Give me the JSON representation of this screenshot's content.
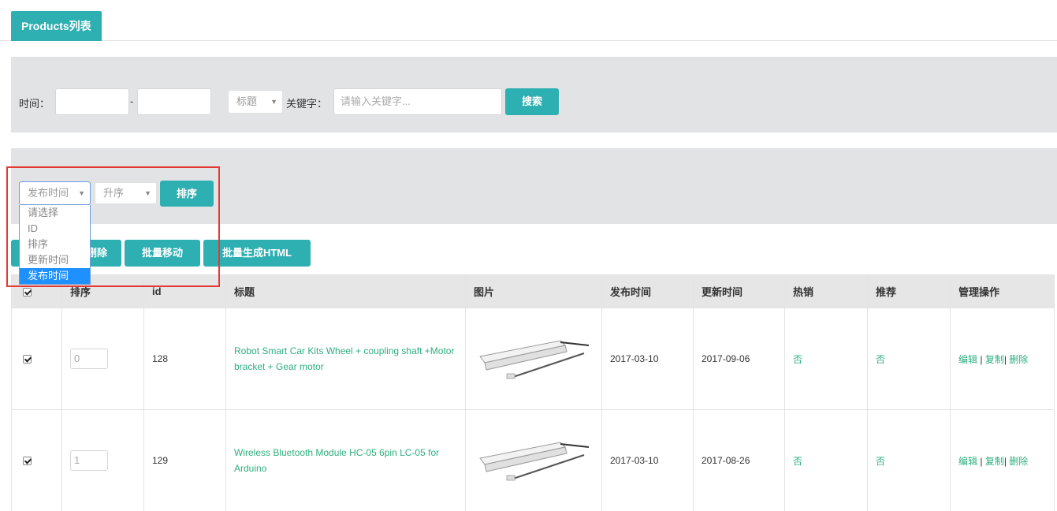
{
  "tab": {
    "label": "Products列表"
  },
  "search": {
    "time_label": "时间：",
    "dash": "-",
    "field_select": "标题",
    "keyword_label": "关键字：",
    "keyword_placeholder": "请输入关键字...",
    "search_button": "搜索"
  },
  "sort": {
    "field_select": "发布时间",
    "order_select": "升序",
    "sort_button": "排序",
    "options": [
      "请选择",
      "ID",
      "排序",
      "更新时间",
      "发布时间"
    ],
    "selected_option": "发布时间"
  },
  "toolbar": {
    "delete_button": "删除",
    "move_button": "批量移动",
    "html_button": "批量生成HTML"
  },
  "table": {
    "headers": [
      "排序",
      "id",
      "标题",
      "图片",
      "发布时间",
      "更新时间",
      "热销",
      "推荐",
      "管理操作"
    ],
    "rows": [
      {
        "sort": "0",
        "id": "128",
        "title": "Robot Smart Car Kits Wheel + coupling shaft +Motor bracket + Gear motor",
        "published": "2017-03-10",
        "updated": "2017-09-06",
        "hot": "否",
        "recommend": "否",
        "edit": "编辑",
        "copy": "复制",
        "delete": "删除"
      },
      {
        "sort": "1",
        "id": "129",
        "title": "Wireless Bluetooth Module HC-05 6pin LC-05 for Arduino",
        "published": "2017-03-10",
        "updated": "2017-08-26",
        "hot": "否",
        "recommend": "否",
        "edit": "编辑",
        "copy": "复制",
        "delete": "删除"
      }
    ]
  },
  "colors": {
    "accent": "#2eafb2",
    "link": "#2eaf80",
    "highlight": "#e53935",
    "selected": "#1e90ff"
  }
}
